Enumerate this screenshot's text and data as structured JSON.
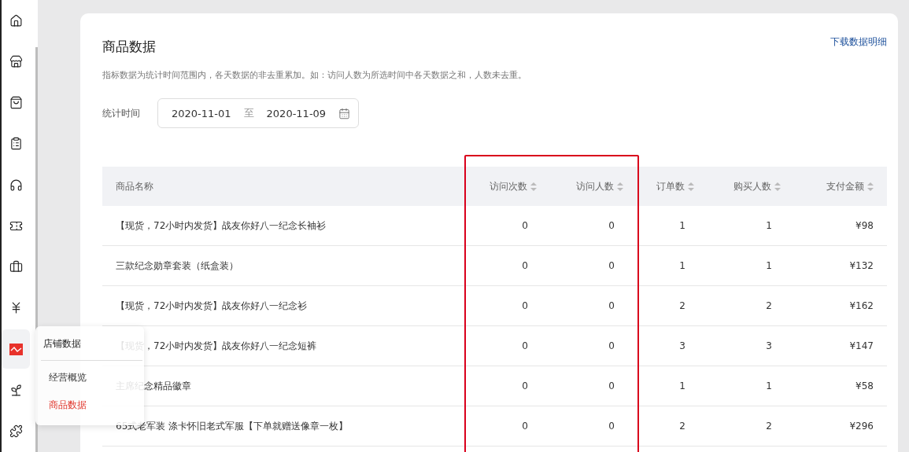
{
  "sidebar": {
    "items": [
      {
        "kind": "home",
        "selected": false
      },
      {
        "kind": "store",
        "selected": false
      },
      {
        "kind": "bag",
        "selected": false
      },
      {
        "kind": "clipboard",
        "selected": false
      },
      {
        "kind": "headset",
        "selected": false
      },
      {
        "kind": "ticket",
        "selected": false
      },
      {
        "kind": "briefcase",
        "selected": false
      },
      {
        "kind": "yen",
        "selected": false
      },
      {
        "kind": "chart",
        "selected": true
      },
      {
        "kind": "sprout",
        "selected": false
      },
      {
        "kind": "puzzle",
        "selected": false
      }
    ]
  },
  "popup_menu": {
    "title": "店铺数据",
    "items": [
      {
        "label": "经营概览",
        "selected": false
      },
      {
        "label": "商品数据",
        "selected": true
      }
    ]
  },
  "page": {
    "title": "商品数据",
    "download_link": "下载数据明细",
    "note": "指标数据为统计时间范围内，各天数据的非去重累加。如：访问人数为所选时间中各天数据之和，人数未去重。",
    "date_filter": {
      "label": "统计时间",
      "start": "2020-11-01",
      "separator": "至",
      "end": "2020-11-09"
    }
  },
  "table": {
    "columns": [
      {
        "label": "商品名称",
        "sortable": false,
        "highlighted": false
      },
      {
        "label": "访问次数",
        "sortable": true,
        "highlighted": true
      },
      {
        "label": "访问人数",
        "sortable": true,
        "highlighted": true
      },
      {
        "label": "订单数",
        "sortable": true,
        "highlighted": false
      },
      {
        "label": "购买人数",
        "sortable": true,
        "highlighted": false
      },
      {
        "label": "支付金额",
        "sortable": true,
        "highlighted": false
      }
    ],
    "rows": [
      [
        "【现货，72小时内发货】战友你好八一纪念长袖衫",
        "0",
        "0",
        "1",
        "1",
        "¥98"
      ],
      [
        "三款纪念勋章套装（纸盒装）",
        "0",
        "0",
        "1",
        "1",
        "¥132"
      ],
      [
        "【现货，72小时内发货】战友你好八一纪念衫",
        "0",
        "0",
        "2",
        "2",
        "¥162"
      ],
      [
        "【现货，72小时内发货】战友你好八一纪念短裤",
        "0",
        "0",
        "3",
        "3",
        "¥147"
      ],
      [
        "主席纪念精品徽章",
        "0",
        "0",
        "1",
        "1",
        "¥58"
      ],
      [
        "65式老军装 涤卡怀旧老式军服【下单就赠送像章一枚】",
        "0",
        "0",
        "2",
        "2",
        "¥296"
      ]
    ]
  }
}
